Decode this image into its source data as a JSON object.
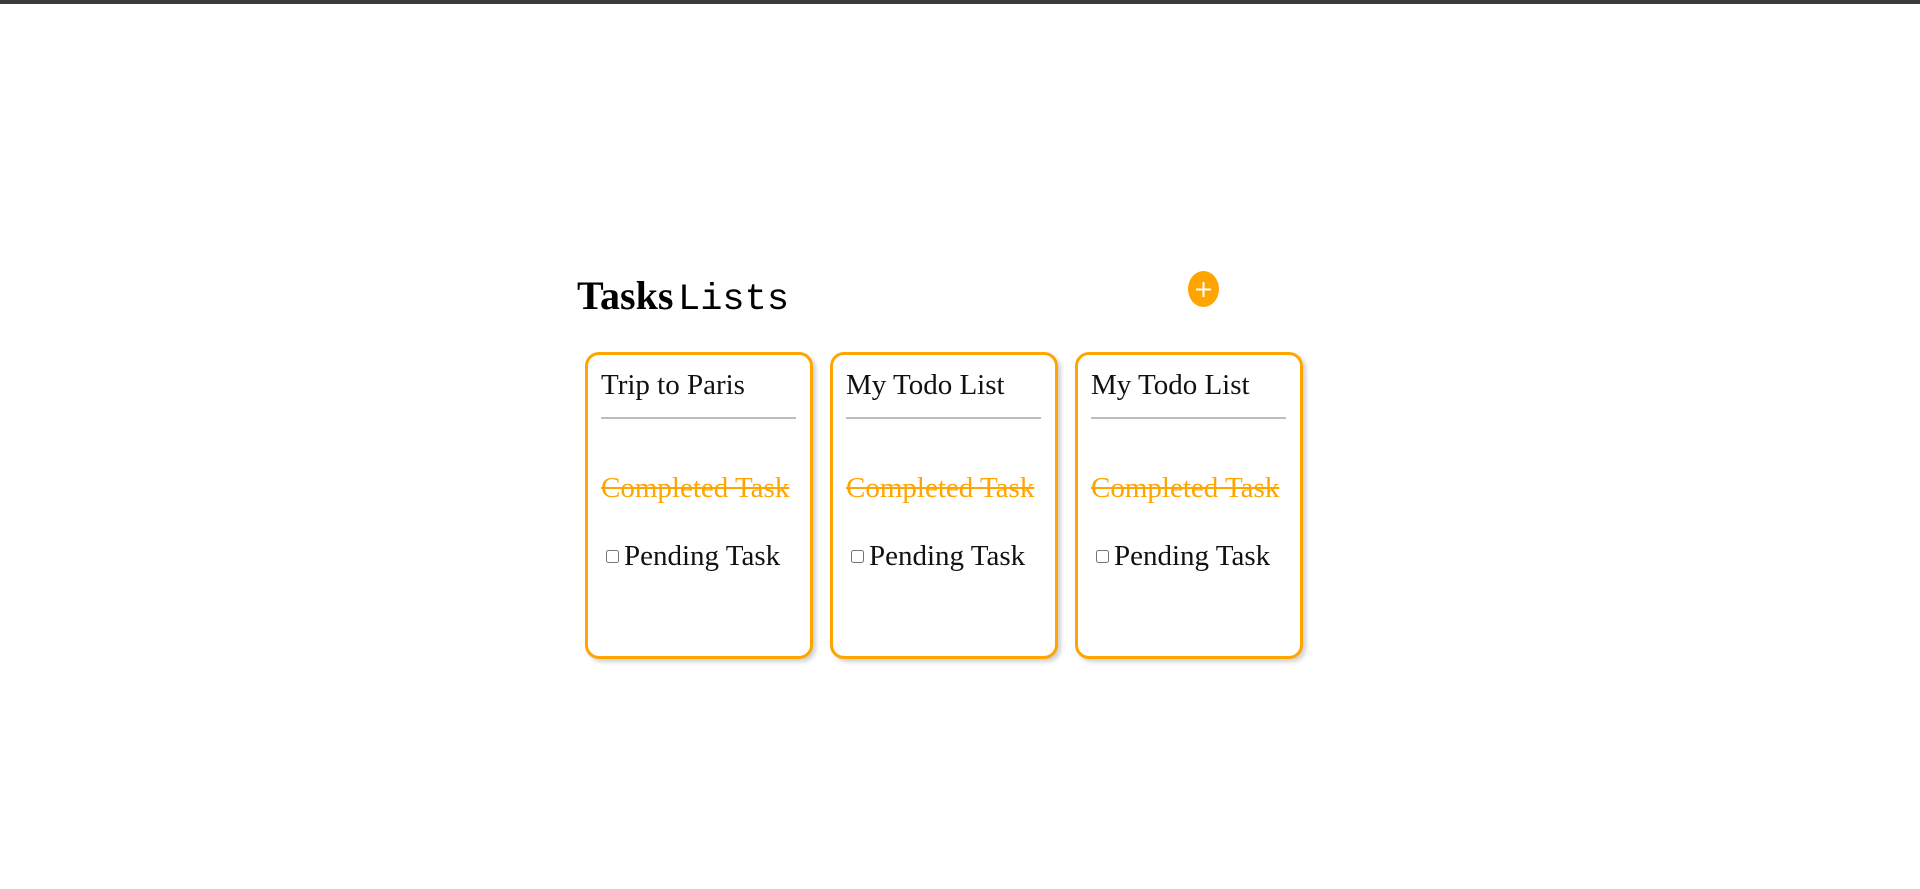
{
  "header": {
    "title_bold": "Tasks",
    "title_mono": "Lists",
    "add_icon": "plus-circle-icon"
  },
  "colors": {
    "accent": "#ffa500",
    "top_bar": "#3a3a3a",
    "divider": "#bdbdbd"
  },
  "lists": [
    {
      "title": "Trip to Paris",
      "completed_task": "Completed Task",
      "pending_task": "Pending Task",
      "pending_checked": false
    },
    {
      "title": "My Todo List",
      "completed_task": "Completed Task",
      "pending_task": "Pending Task",
      "pending_checked": false
    },
    {
      "title": "My Todo List",
      "completed_task": "Completed Task",
      "pending_task": "Pending Task",
      "pending_checked": false
    }
  ]
}
